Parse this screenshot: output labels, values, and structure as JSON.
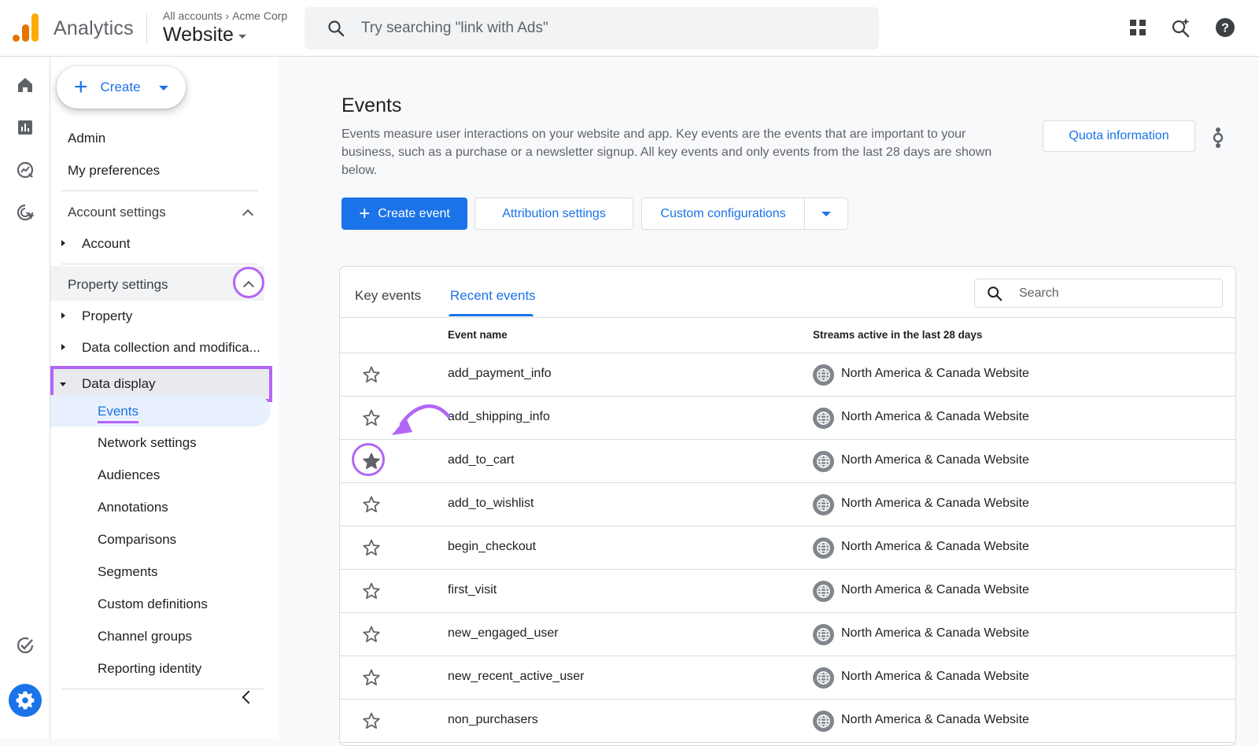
{
  "header": {
    "app_name": "Analytics",
    "breadcrumb": [
      "All accounts",
      "Acme Corp"
    ],
    "property": "Website",
    "search_placeholder": "Try searching \"link with Ads\"",
    "icons": [
      "apps-grid-icon",
      "search-insights-icon",
      "help-icon"
    ]
  },
  "rail": {
    "icons": [
      "home-icon",
      "reports-icon",
      "explore-icon",
      "advertising-icon",
      "checklist-icon",
      "admin-gear-icon"
    ]
  },
  "sidebar": {
    "create_label": "Create",
    "admin": "Admin",
    "my_preferences": "My preferences",
    "account_settings": "Account settings",
    "account": "Account",
    "property_settings": "Property settings",
    "property": "Property",
    "data_collection": "Data collection and modifica...",
    "data_display": "Data display",
    "data_display_items": [
      "Events",
      "Network settings",
      "Audiences",
      "Annotations",
      "Comparisons",
      "Segments",
      "Custom definitions",
      "Channel groups",
      "Reporting identity"
    ]
  },
  "main": {
    "title": "Events",
    "description": "Events measure user interactions on your website and app. Key events are the events that are important to your business, such as a purchase or a newsletter signup. All key events and only events from the last 28 days are shown below.",
    "quota_button": "Quota information",
    "create_event": "Create event",
    "attribution_settings": "Attribution settings",
    "custom_configurations": "Custom configurations"
  },
  "table": {
    "tabs": [
      "Key events",
      "Recent events"
    ],
    "active_tab": "Recent events",
    "search_placeholder": "Search",
    "headers": {
      "event_name": "Event name",
      "streams": "Streams active in the last 28 days"
    },
    "rows": [
      {
        "name": "add_payment_info",
        "stream": "North America & Canada Website",
        "key_event": false
      },
      {
        "name": "add_shipping_info",
        "stream": "North America & Canada Website",
        "key_event": false
      },
      {
        "name": "add_to_cart",
        "stream": "North America & Canada Website",
        "key_event": true
      },
      {
        "name": "add_to_wishlist",
        "stream": "North America & Canada Website",
        "key_event": false
      },
      {
        "name": "begin_checkout",
        "stream": "North America & Canada Website",
        "key_event": false
      },
      {
        "name": "first_visit",
        "stream": "North America & Canada Website",
        "key_event": false
      },
      {
        "name": "new_engaged_user",
        "stream": "North America & Canada Website",
        "key_event": false
      },
      {
        "name": "new_recent_active_user",
        "stream": "North America & Canada Website",
        "key_event": false
      },
      {
        "name": "non_purchasers",
        "stream": "North America & Canada Website",
        "key_event": false
      }
    ]
  },
  "colors": {
    "accent": "#1a73e8",
    "highlight": "#b266f5"
  }
}
